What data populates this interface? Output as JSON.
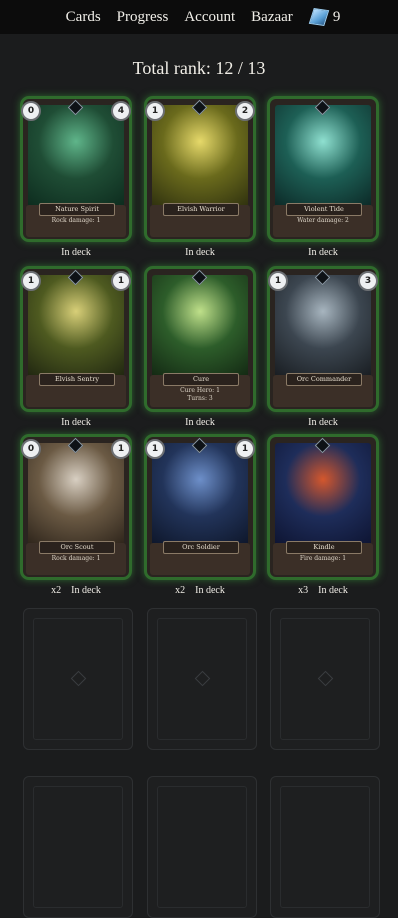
{
  "nav": {
    "items": [
      "Cards",
      "Progress",
      "Account",
      "Bazaar"
    ],
    "gem_count": "9"
  },
  "header": {
    "title": "Total rank: 12 / 13"
  },
  "cards": [
    {
      "name": "Nature Spirit",
      "left": "0",
      "right": "4",
      "effect": "Rock damage: 1",
      "status": "In deck",
      "count": "",
      "palette": [
        "#1f4d35",
        "#5fb58a",
        "#0c2a1d"
      ]
    },
    {
      "name": "Elvish Warrior",
      "left": "1",
      "right": "2",
      "effect": "",
      "status": "In deck",
      "count": "",
      "palette": [
        "#6a6a1c",
        "#e6d96a",
        "#2c2e0e"
      ]
    },
    {
      "name": "Violent Tide",
      "left": "",
      "right": "",
      "effect": "Water damage: 2",
      "status": "In deck",
      "count": "",
      "palette": [
        "#1d5f55",
        "#8fe0d0",
        "#0b2624"
      ]
    },
    {
      "name": "Elvish Sentry",
      "left": "1",
      "right": "1",
      "effect": "",
      "status": "In deck",
      "count": "",
      "palette": [
        "#4e5a20",
        "#d8cf78",
        "#1e2410"
      ]
    },
    {
      "name": "Cure",
      "left": "",
      "right": "",
      "effect": "Cure Hero: 1\nTurns: 3",
      "status": "In deck",
      "count": "",
      "palette": [
        "#2d5d2a",
        "#bfe08a",
        "#122612"
      ]
    },
    {
      "name": "Orc Commander",
      "left": "1",
      "right": "3",
      "effect": "",
      "status": "In deck",
      "count": "",
      "palette": [
        "#3c4650",
        "#a7b5bf",
        "#171b1f"
      ]
    },
    {
      "name": "Orc Scout",
      "left": "0",
      "right": "1",
      "effect": "Rock damage: 1",
      "status": "In deck",
      "count": "x2",
      "palette": [
        "#6b5a44",
        "#d8cfc2",
        "#2b2219"
      ]
    },
    {
      "name": "Orc Soldier",
      "left": "1",
      "right": "1",
      "effect": "",
      "status": "In deck",
      "count": "x2",
      "palette": [
        "#22345a",
        "#6d8fc9",
        "#0d1528"
      ]
    },
    {
      "name": "Kindle",
      "left": "",
      "right": "",
      "effect": "Fire damage: 1",
      "status": "In deck",
      "count": "x3",
      "palette": [
        "#1e2d5a",
        "#d4572d",
        "#0d1330"
      ]
    }
  ]
}
